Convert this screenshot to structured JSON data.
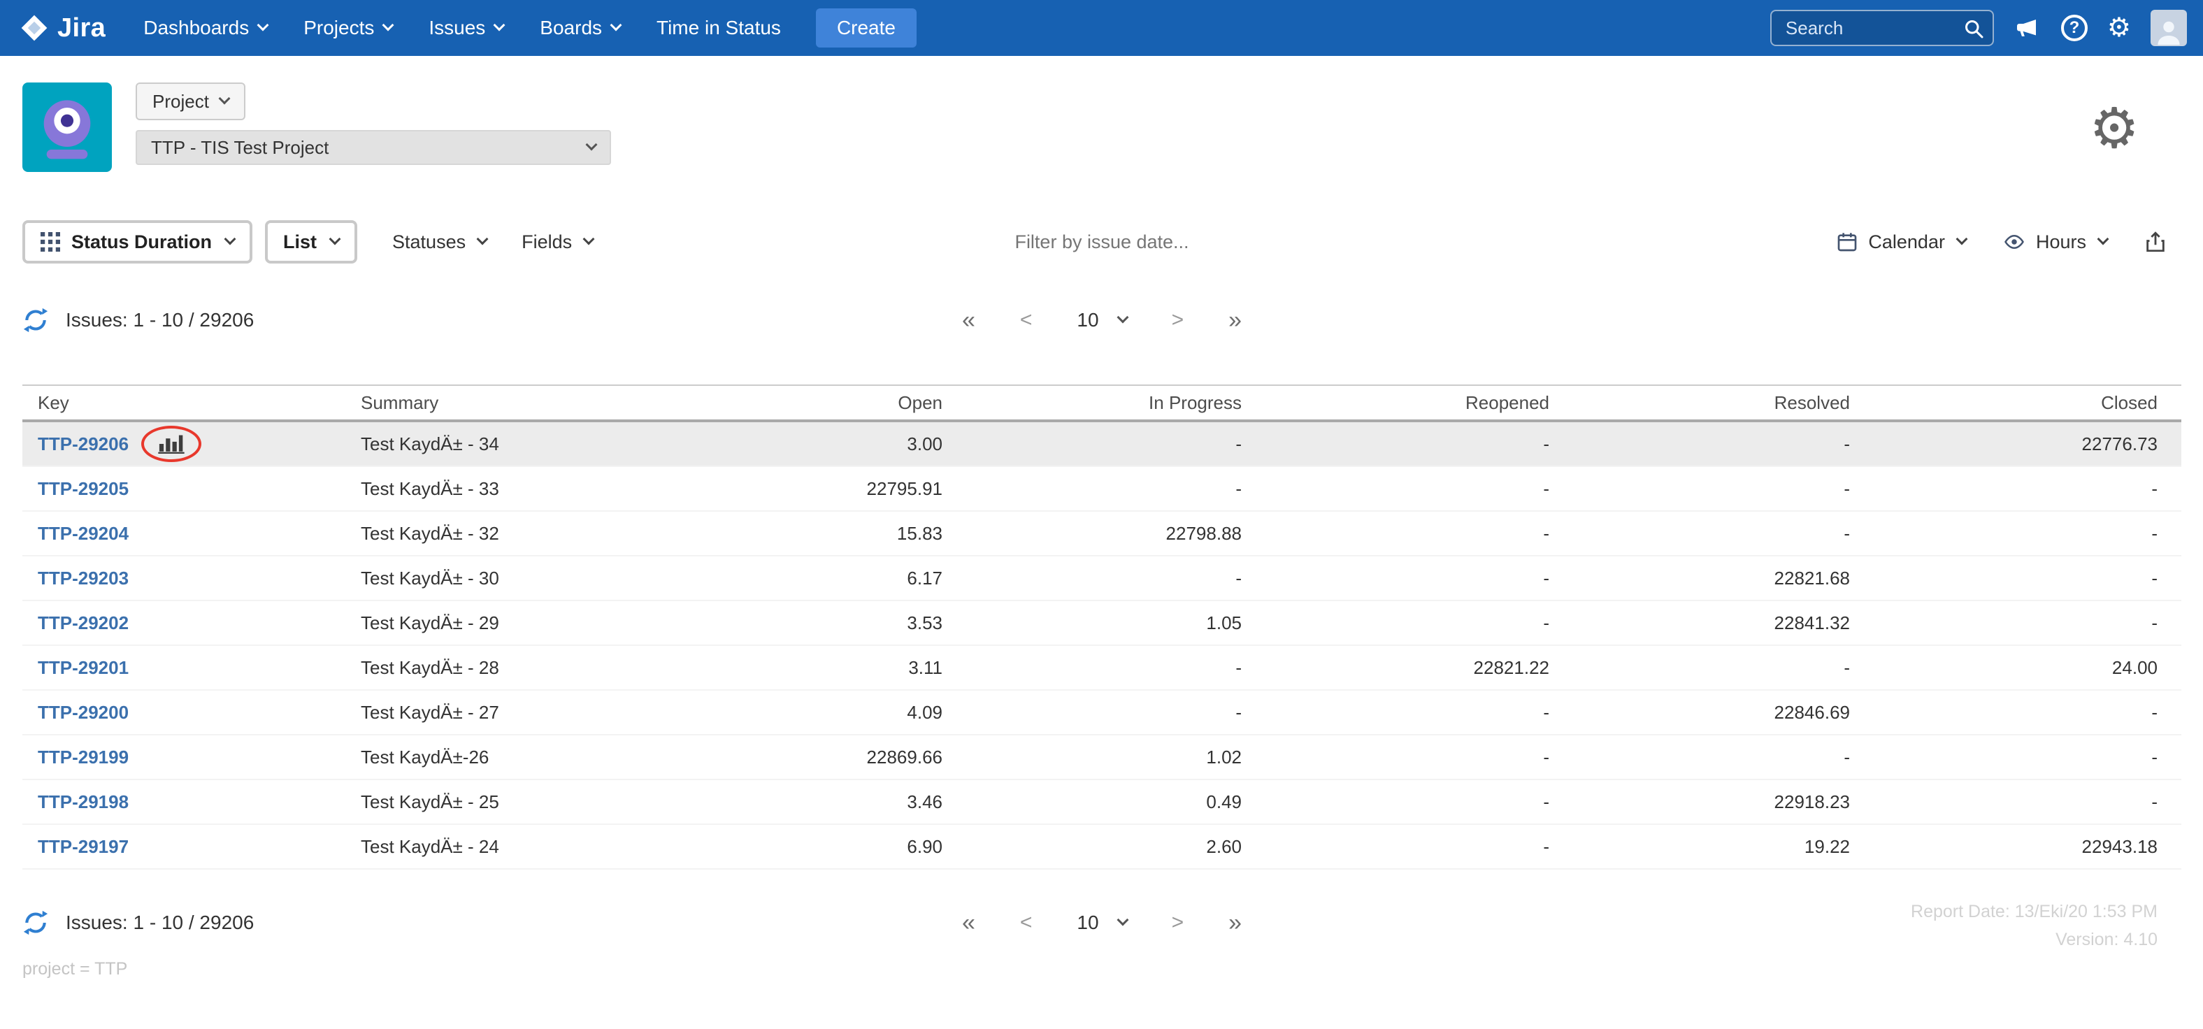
{
  "navbar": {
    "brand": "Jira",
    "items": [
      {
        "label": "Dashboards",
        "chevron": true
      },
      {
        "label": "Projects",
        "chevron": true
      },
      {
        "label": "Issues",
        "chevron": true
      },
      {
        "label": "Boards",
        "chevron": true
      },
      {
        "label": "Time in Status",
        "chevron": false
      }
    ],
    "create_label": "Create",
    "search_placeholder": "Search"
  },
  "icons": {
    "help_glyph": "?",
    "gear_glyph": "⚙"
  },
  "project_header": {
    "project_button_label": "Project",
    "project_select_value": "TTP - TIS Test Project"
  },
  "toolbar": {
    "report_type_label": "Status Duration",
    "view_label": "List",
    "statuses_label": "Statuses",
    "fields_label": "Fields",
    "filter_placeholder": "Filter by issue date...",
    "calendar_label": "Calendar",
    "time_unit_label": "Hours"
  },
  "results": {
    "count_text": "Issues: 1 - 10 / 29206",
    "page_size": "10"
  },
  "pagination": {
    "first": "«",
    "prev": "<",
    "next": ">",
    "last": "»"
  },
  "table": {
    "columns": [
      "Key",
      "Summary",
      "Open",
      "In Progress",
      "Reopened",
      "Resolved",
      "Closed"
    ],
    "rows": [
      {
        "key": "TTP-29206",
        "summary": "Test KaydÄ± - 34",
        "open": "3.00",
        "in_progress": "-",
        "reopened": "-",
        "resolved": "-",
        "closed": "22776.73",
        "highlighted": true,
        "has_chart_icon": true
      },
      {
        "key": "TTP-29205",
        "summary": "Test KaydÄ± - 33",
        "open": "22795.91",
        "in_progress": "-",
        "reopened": "-",
        "resolved": "-",
        "closed": "-",
        "highlighted": false,
        "has_chart_icon": false
      },
      {
        "key": "TTP-29204",
        "summary": "Test KaydÄ± - 32",
        "open": "15.83",
        "in_progress": "22798.88",
        "reopened": "-",
        "resolved": "-",
        "closed": "-",
        "highlighted": false,
        "has_chart_icon": false
      },
      {
        "key": "TTP-29203",
        "summary": "Test KaydÄ± - 30",
        "open": "6.17",
        "in_progress": "-",
        "reopened": "-",
        "resolved": "22821.68",
        "closed": "-",
        "highlighted": false,
        "has_chart_icon": false
      },
      {
        "key": "TTP-29202",
        "summary": "Test KaydÄ± - 29",
        "open": "3.53",
        "in_progress": "1.05",
        "reopened": "-",
        "resolved": "22841.32",
        "closed": "-",
        "highlighted": false,
        "has_chart_icon": false
      },
      {
        "key": "TTP-29201",
        "summary": "Test KaydÄ± - 28",
        "open": "3.11",
        "in_progress": "-",
        "reopened": "22821.22",
        "resolved": "-",
        "closed": "24.00",
        "highlighted": false,
        "has_chart_icon": false
      },
      {
        "key": "TTP-29200",
        "summary": "Test KaydÄ± - 27",
        "open": "4.09",
        "in_progress": "-",
        "reopened": "-",
        "resolved": "22846.69",
        "closed": "-",
        "highlighted": false,
        "has_chart_icon": false
      },
      {
        "key": "TTP-29199",
        "summary": "Test KaydÄ±-26",
        "open": "22869.66",
        "in_progress": "1.02",
        "reopened": "-",
        "resolved": "-",
        "closed": "-",
        "highlighted": false,
        "has_chart_icon": false
      },
      {
        "key": "TTP-29198",
        "summary": "Test KaydÄ± - 25",
        "open": "3.46",
        "in_progress": "0.49",
        "reopened": "-",
        "resolved": "22918.23",
        "closed": "-",
        "highlighted": false,
        "has_chart_icon": false
      },
      {
        "key": "TTP-29197",
        "summary": "Test KaydÄ± - 24",
        "open": "6.90",
        "in_progress": "2.60",
        "reopened": "-",
        "resolved": "19.22",
        "closed": "22943.18",
        "highlighted": false,
        "has_chart_icon": false
      }
    ]
  },
  "footer": {
    "count_text": "Issues: 1 - 10 / 29206",
    "page_size": "10",
    "report_date": "Report Date: 13/Eki/20 1:53 PM",
    "version": "Version: 4.10",
    "query_text": "project = TTP"
  },
  "colors": {
    "navbar_blue": "#1761b2",
    "create_button_blue": "#3f83d9",
    "link_blue": "#3b70ad",
    "row_highlight": "#ececec",
    "annotation_red": "#e8382c",
    "project_avatar_teal": "#00a3bf",
    "project_avatar_purple": "#8777d9"
  }
}
